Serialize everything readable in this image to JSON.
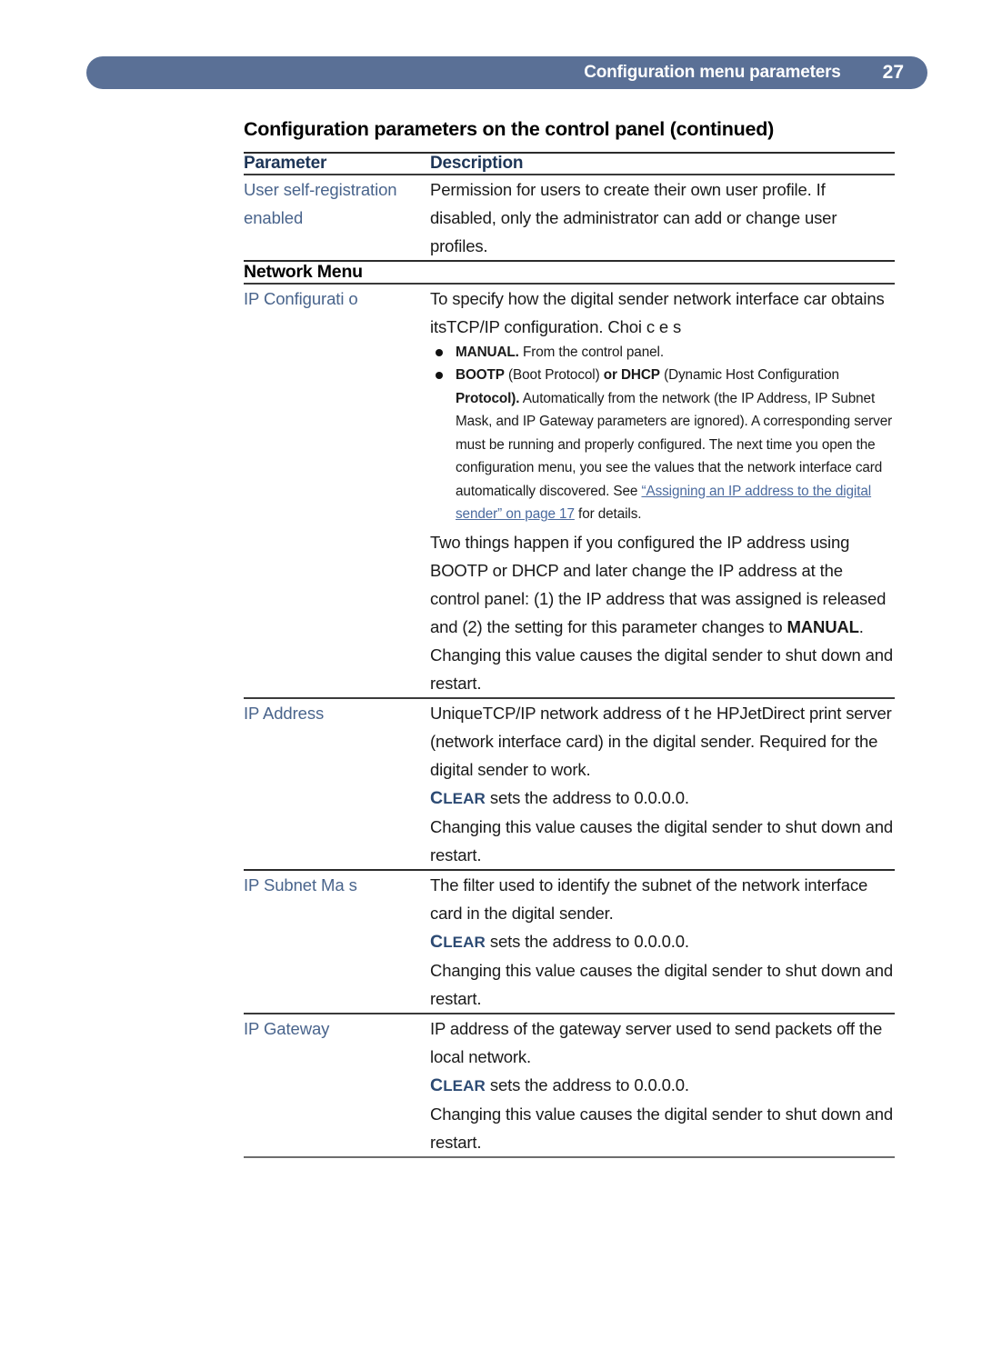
{
  "header": {
    "title": "Configuration menu parameters",
    "page_number": "27",
    "bar_color": "#5a7096"
  },
  "doc": {
    "title": "Configuration parameters on the control panel (continued)"
  },
  "table": {
    "columns": {
      "parameter": "Parameter",
      "description": "Description"
    },
    "rows": [
      {
        "parameter": "User self-registration enabled",
        "description": "Permission for users to create their own user profile. If disabled, only the administrator can add or change user profiles."
      },
      {
        "section_heading": "Network Menu"
      },
      {
        "parameter": "IP Configurati o",
        "intro": "To specify how the digital sender network interface car obtains itsTCP/IP configuration. Choi  c  e  s",
        "bullets": [
          {
            "bold_lead": "MANUAL.",
            "rest": " From the control panel."
          },
          {
            "segments": [
              {
                "text": "BOOTP",
                "style": "bold"
              },
              {
                "text": " (Boot Protocol) ",
                "style": "normal"
              },
              {
                "text": "or DHCP",
                "style": "bold"
              },
              {
                "text": " (Dynamic Host Configuration ",
                "style": "normal"
              },
              {
                "text": "Protocol).",
                "style": "bold"
              },
              {
                "text": " Automatically from the network (the IP Address, IP Subnet Mask, and IP Gateway parameters are ignored). A corresponding server must be running and properly configured. The next time you open the configuration menu, you see the values that the network interface card automatically discovered. See ",
                "style": "normal"
              },
              {
                "text": "“Assigning an IP address to the digital sender” on page 17",
                "style": "link"
              },
              {
                "text": " for details.",
                "style": "normal"
              }
            ]
          }
        ],
        "paragraphs": [
          {
            "segments": [
              {
                "text": "Two things happen if you configured the IP address using BOOTP or DHCP and later change the IP address at the control panel: (1) the IP address that was assigned is released and (2) the setting for this parameter changes to ",
                "style": "normal"
              },
              {
                "text": "MANUAL",
                "style": "bold"
              },
              {
                "text": ".",
                "style": "normal"
              }
            ]
          },
          {
            "segments": [
              {
                "text": "Changing this value causes the digital sender to shut down and restart.",
                "style": "normal"
              }
            ]
          }
        ]
      },
      {
        "parameter": "IP Address",
        "paragraphs": [
          {
            "segments": [
              {
                "text": "UniqueTCP/IP network address of t he HPJetDirect print server (network interface card) in the digital sender. Required for the digital sender to work.",
                "style": "normal"
              }
            ]
          },
          {
            "segments": [
              {
                "text": "CLEAR",
                "style": "smallcaps"
              },
              {
                "text": " sets the address to 0.0.0.0.",
                "style": "normal"
              }
            ]
          },
          {
            "segments": [
              {
                "text": "Changing this value causes the digital sender to shut down and restart.",
                "style": "normal"
              }
            ]
          }
        ]
      },
      {
        "parameter": "IP Subnet Ma  s",
        "paragraphs": [
          {
            "segments": [
              {
                "text": "The filter used to identify the subnet of the network interface card in the digital sender.",
                "style": "normal"
              }
            ]
          },
          {
            "segments": [
              {
                "text": "CLEAR",
                "style": "smallcaps"
              },
              {
                "text": " sets the address to 0.0.0.0.",
                "style": "normal"
              }
            ]
          },
          {
            "segments": [
              {
                "text": "Changing this value causes the digital sender to shut down and restart.",
                "style": "normal"
              }
            ]
          }
        ]
      },
      {
        "parameter": "IP Gateway",
        "paragraphs": [
          {
            "segments": [
              {
                "text": "IP address of the gateway server used to send packets off the local network.",
                "style": "normal"
              }
            ]
          },
          {
            "segments": [
              {
                "text": "CLEAR",
                "style": "smallcaps"
              },
              {
                "text": " sets the address to 0.0.0.0.",
                "style": "normal"
              }
            ]
          },
          {
            "segments": [
              {
                "text": "Changing this value causes the digital sender to shut down and restart.",
                "style": "normal"
              }
            ]
          }
        ]
      }
    ]
  },
  "colors": {
    "header_bar": "#5a7096",
    "parameter_text": "#49648c",
    "column_header_text": "#1d3557",
    "link": "#4a6a9e",
    "clear_keyword": "#2c4a73",
    "rule": "#2b2b2b"
  }
}
